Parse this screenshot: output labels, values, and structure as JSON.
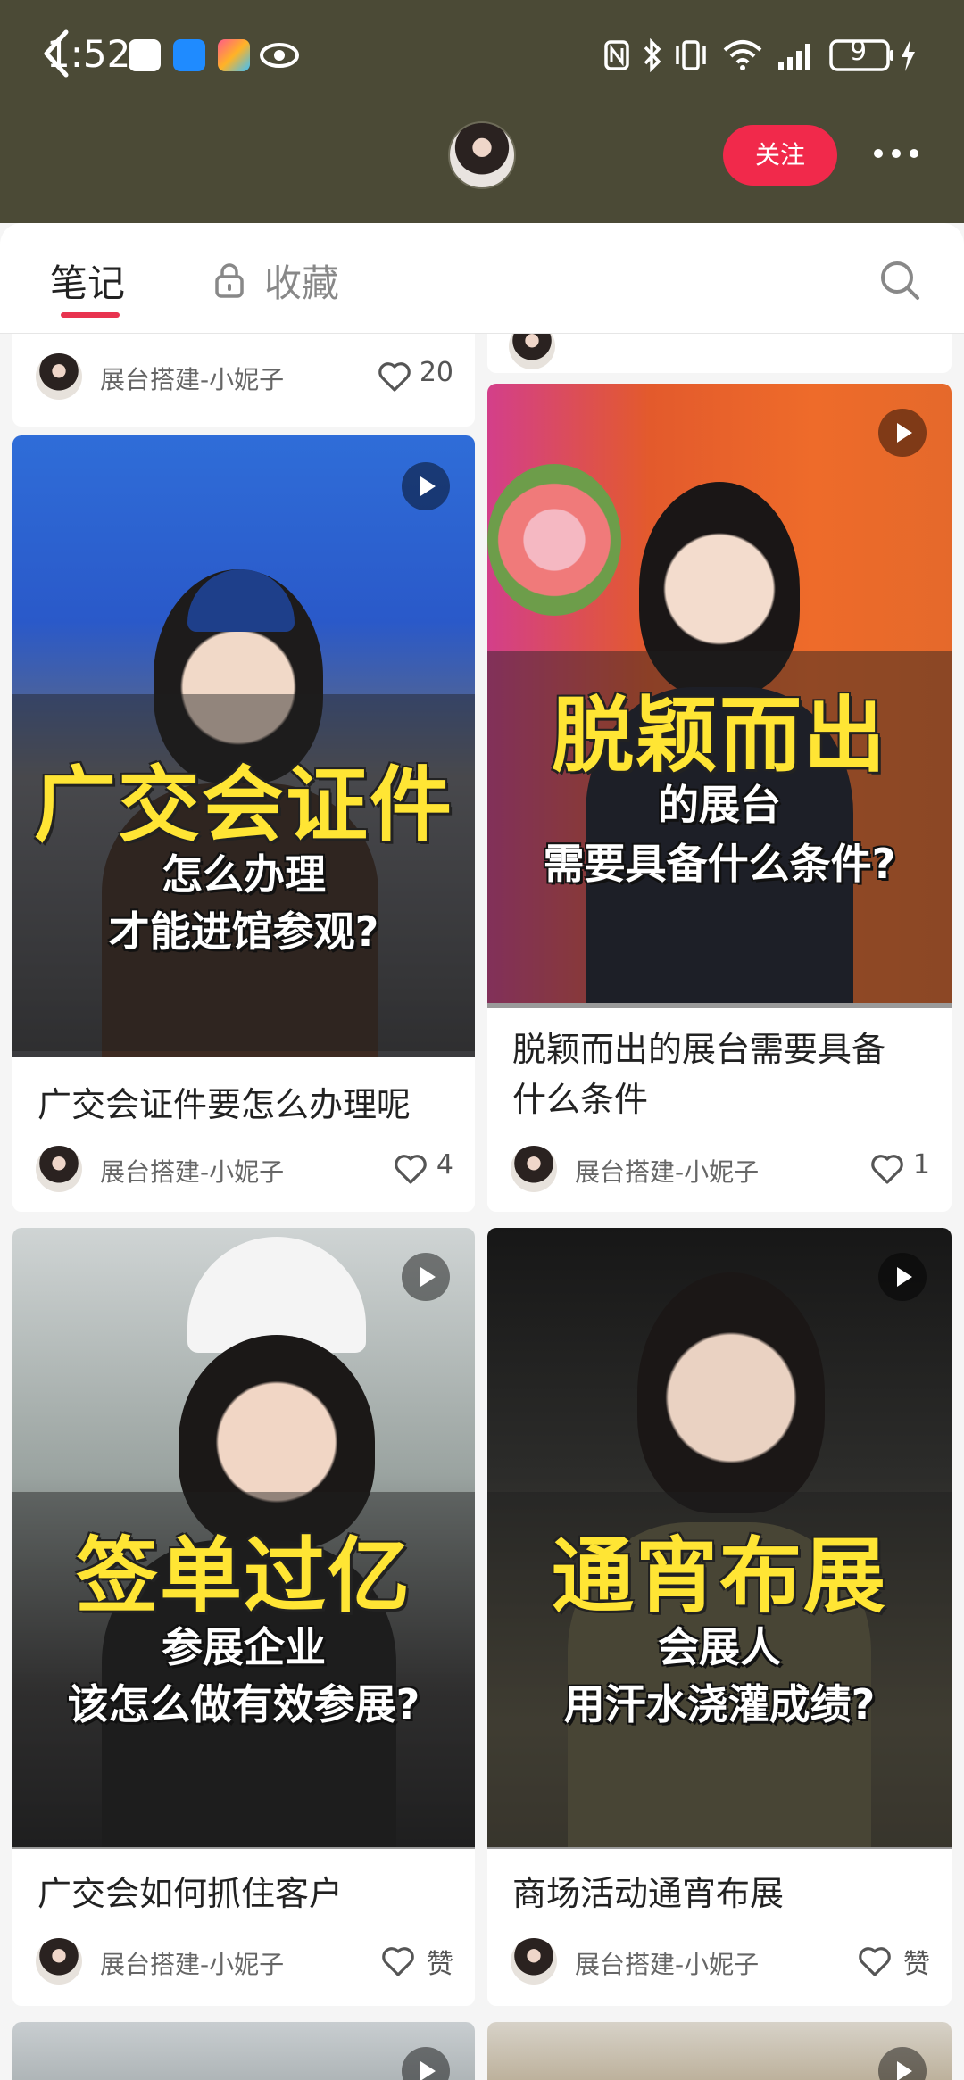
{
  "status_bar": {
    "time": "1:52",
    "battery": "9"
  },
  "nav": {
    "follow_label": "关注"
  },
  "tabs": {
    "notes": "笔记",
    "favorites": "收藏"
  },
  "cards": [
    {
      "author": "展台搭建-小妮子",
      "likes": "20"
    },
    {
      "thumbnail_headline": "广交会证件",
      "thumbnail_sub_1": "怎么办理",
      "thumbnail_sub_2": "才能进馆参观?",
      "title": "广交会证件要怎么办理呢",
      "author": "展台搭建-小妮子",
      "likes": "4"
    },
    {
      "thumbnail_headline": "脱颖而出",
      "thumbnail_sub_1": "的展台",
      "thumbnail_sub_2": "需要具备什么条件?",
      "title_line1": "脱颖而出的展台需要具备",
      "title_line2": "什么条件",
      "author": "展台搭建-小妮子",
      "likes": "1"
    },
    {
      "thumbnail_headline": "签单过亿",
      "thumbnail_sub_1": "参展企业",
      "thumbnail_sub_2": "该怎么做有效参展?",
      "title": "广交会如何抓住客户",
      "author": "展台搭建-小妮子",
      "likes": "赞"
    },
    {
      "thumbnail_headline": "通宵布展",
      "thumbnail_sub_1": "会展人",
      "thumbnail_sub_2": "用汗水浇灌成绩?",
      "title": "商场活动通宵布展",
      "author": "展台搭建-小妮子",
      "likes": "赞"
    }
  ],
  "colors": {
    "header_bg": "#4b4a36",
    "accent_red": "#f1294b",
    "headline_yellow": "#ffe534"
  }
}
